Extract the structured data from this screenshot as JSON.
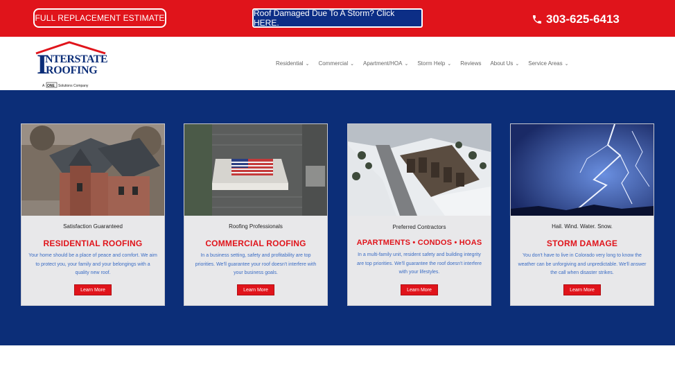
{
  "topbar": {
    "estimate_label": "FULL REPLACEMENT ESTIMATE",
    "storm_label": "Roof Damaged Due To A Storm? Click HERE.",
    "phone": "303-625-6413",
    "phone_icon": "phone-icon"
  },
  "logo": {
    "line1": "NTERSTATE",
    "letter_i": "I",
    "line2": "ROOFING",
    "tagline_a": "A",
    "tagline_one": "ONE",
    "tagline_rest": "Solutions Company"
  },
  "nav": {
    "items": [
      {
        "label": "Residential",
        "dropdown": true
      },
      {
        "label": "Commercial",
        "dropdown": true
      },
      {
        "label": "Apartment/HOA",
        "dropdown": true
      },
      {
        "label": "Storm Help",
        "dropdown": true
      },
      {
        "label": "Reviews",
        "dropdown": false
      },
      {
        "label": "About Us",
        "dropdown": true
      },
      {
        "label": "Service Areas",
        "dropdown": true
      }
    ]
  },
  "cards": [
    {
      "subtitle": "Satisfaction Guaranteed",
      "title": "RESIDENTIAL ROOFING",
      "text": "Your home should be a place of peace and comfort. We aim to protect you, your family and your belongings with a quality new roof.",
      "button": "Learn More"
    },
    {
      "subtitle": "Roofing Professionals",
      "title": "COMMERCIAL ROOFING",
      "text": "In a business setting, safety and profitability are top priorities. We'll guarantee your roof doesn't interfere with your business goals.",
      "button": "Learn More"
    },
    {
      "subtitle": "Preferred Contractors",
      "title": "APARTMENTS • CONDOS • HOAS",
      "text": "In a multi-family unit, resident safety and building integrity are top priorities. We'll guarantee the roof doesn't interfere with your lifestyles.",
      "button": "Learn More"
    },
    {
      "subtitle": "Hail. Wind. Water. Snow.",
      "title": "STORM DAMAGE",
      "text": "You don't have to live in Colorado very long to know the weather can be unforgiving and unpredictable. We'll answer the call when disaster strikes.",
      "button": "Learn More"
    }
  ],
  "colors": {
    "brand_red": "#e0141b",
    "brand_blue": "#0c2e78",
    "card_bg": "#e8e8ea",
    "body_text_blue": "#3a6cc4"
  }
}
